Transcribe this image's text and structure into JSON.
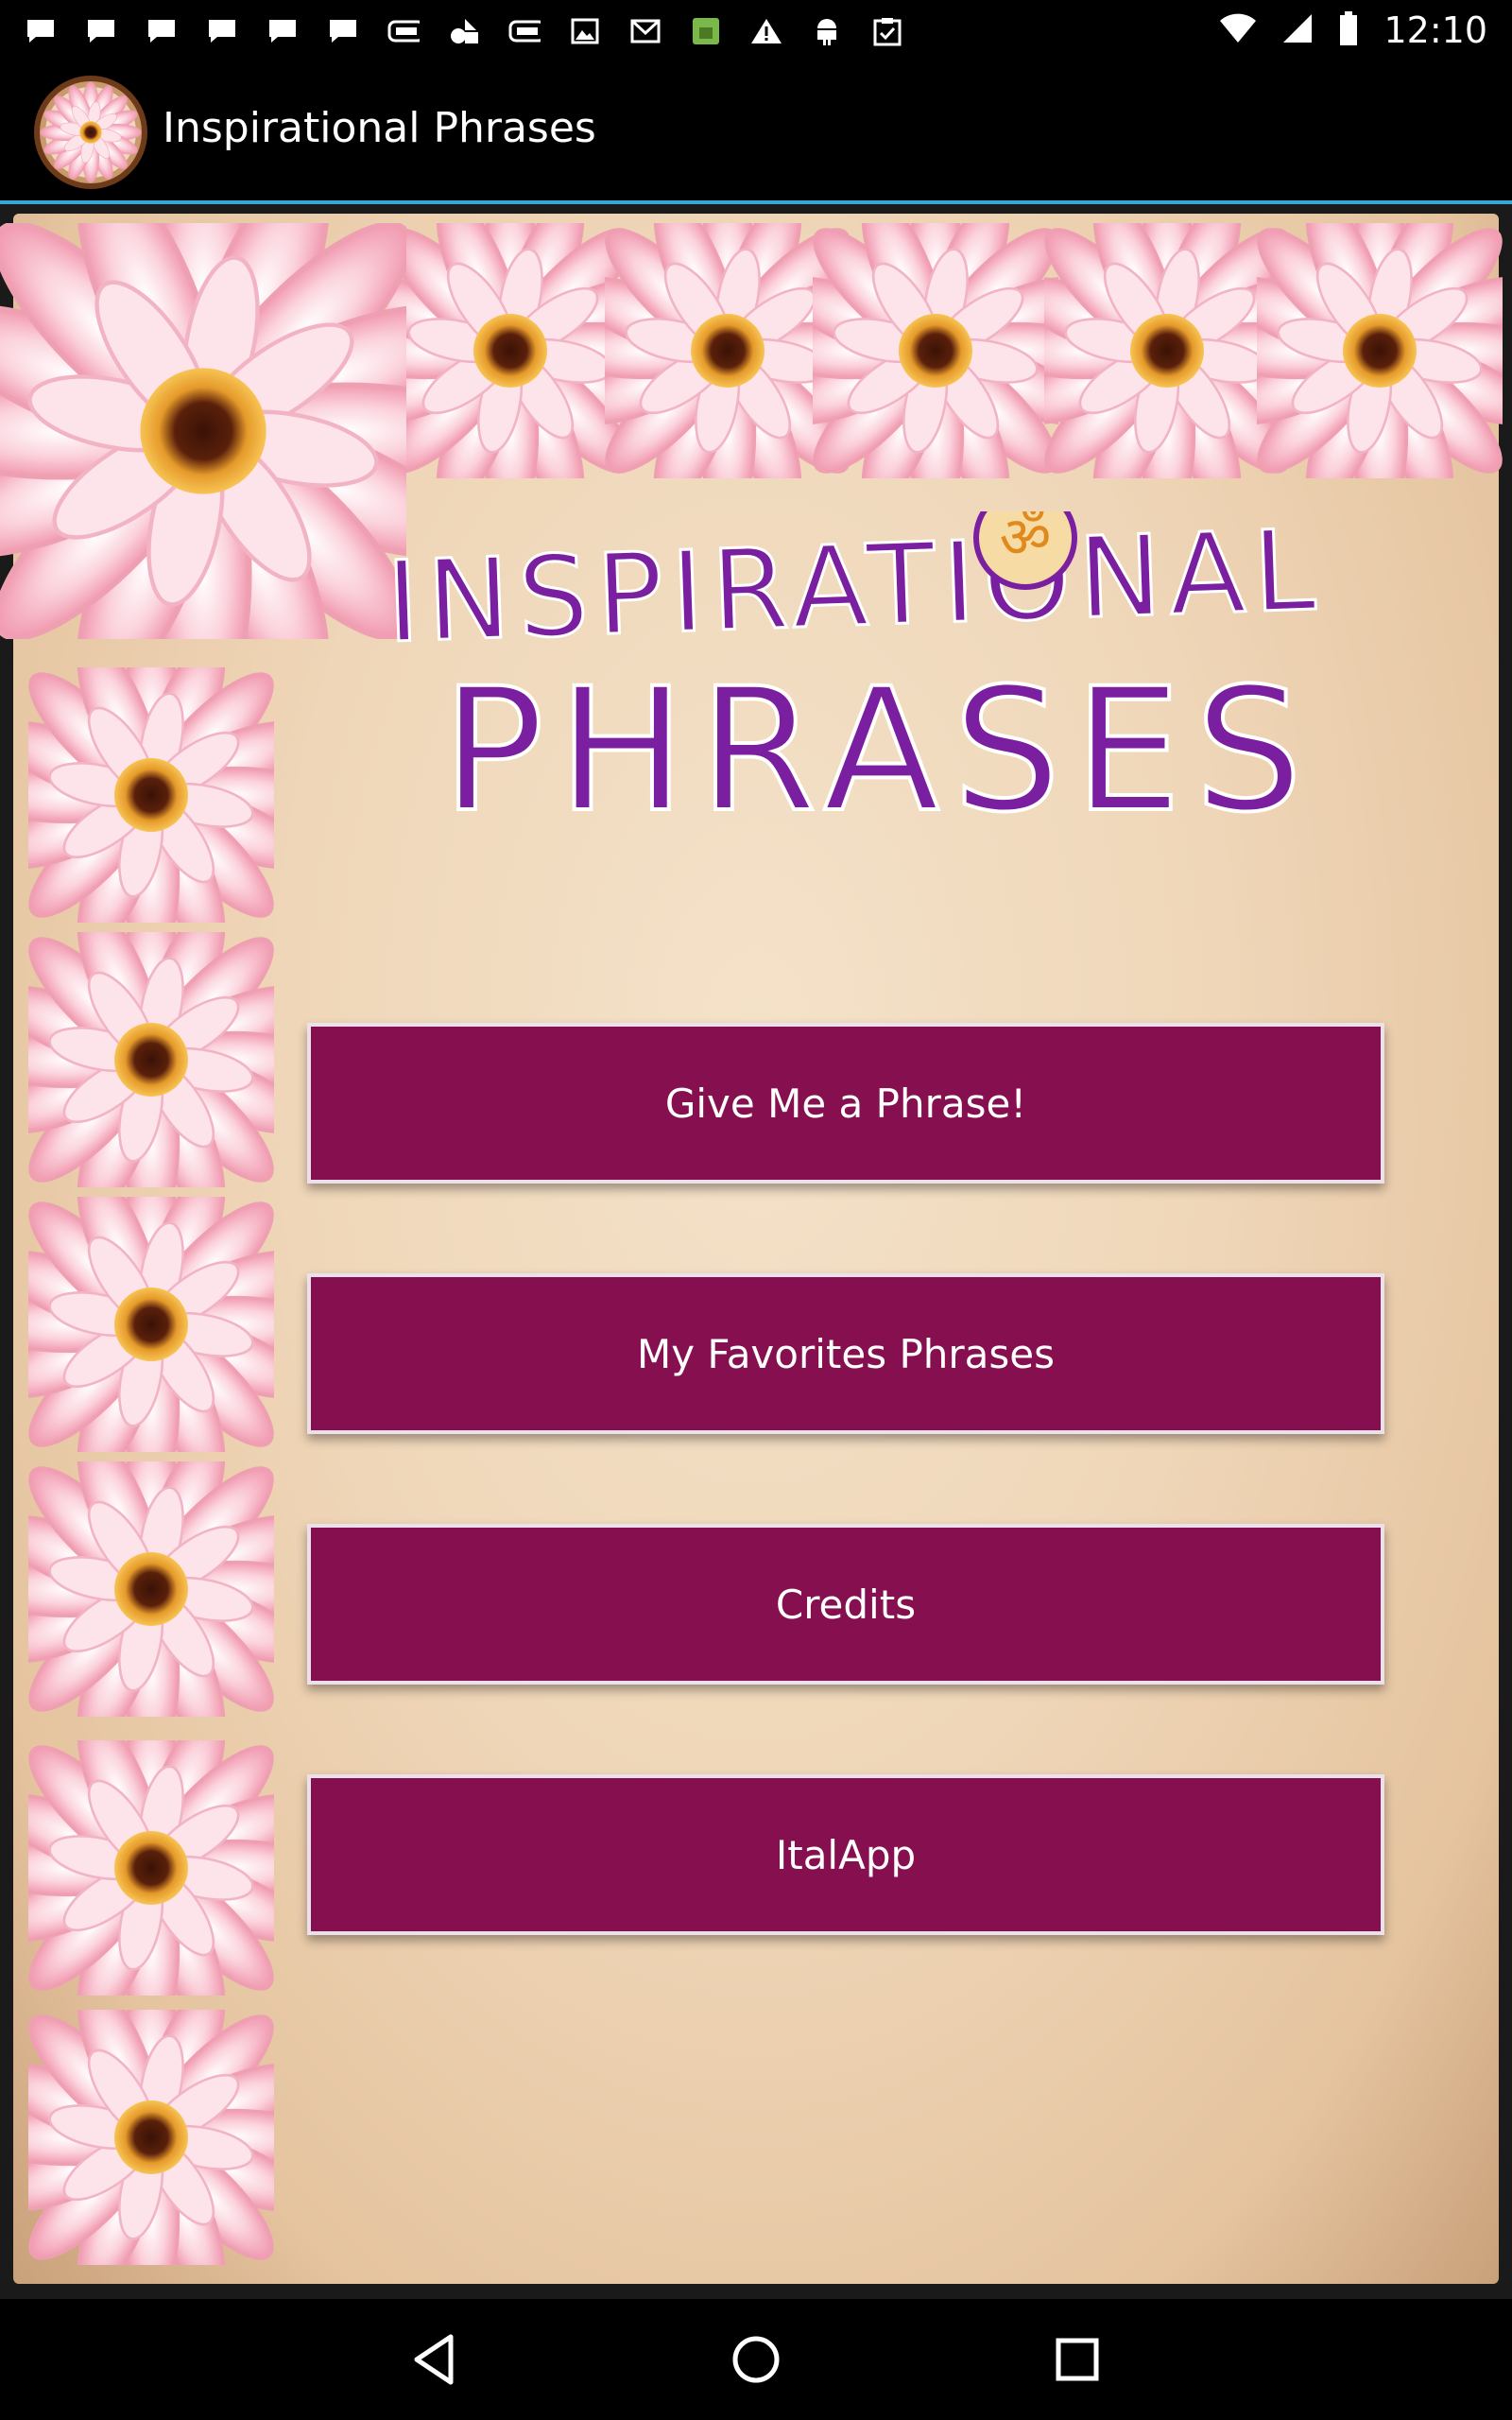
{
  "status_bar": {
    "time": "12:10",
    "notification_icons": [
      "chat-icon",
      "chat-icon",
      "chat-icon",
      "chat-icon",
      "chat-icon",
      "chat-icon",
      "battery-card-icon",
      "android-icon",
      "battery-card-icon",
      "image-icon",
      "gmail-icon",
      "android-app-icon",
      "warning-icon",
      "android-robot-icon",
      "clipboard-check-icon"
    ],
    "system_icons": [
      "wifi-icon",
      "signal-icon",
      "battery-icon"
    ]
  },
  "app_bar": {
    "title": "Inspirational Phrases"
  },
  "logo": {
    "line1": "INSPIRATIONAL",
    "line2": "PHRASES",
    "accent_color": "#7a1fa0"
  },
  "menu": {
    "buttons": [
      {
        "label": "Give Me a Phrase!"
      },
      {
        "label": "My Favorites Phrases"
      },
      {
        "label": "Credits"
      },
      {
        "label": "ItalApp"
      }
    ],
    "button_color": "#850f4f"
  },
  "nav_bar": {
    "buttons": [
      "back-icon",
      "home-icon",
      "recents-icon"
    ]
  }
}
